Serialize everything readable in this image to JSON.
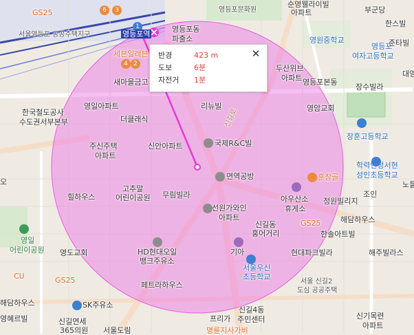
{
  "popup": {
    "radius_key": "반경",
    "radius_value": "423 m",
    "walk_key": "도보",
    "walk_value": "6분",
    "bike_key": "자전거",
    "bike_value": "1분",
    "close_icon": "close-icon"
  },
  "labels": {
    "gs25_top": "GS25",
    "seoul_hangul": "서울영등포 공공주택지구",
    "station": "영등포역",
    "yeongdeungpo_transfer": "영등포역",
    "yeongdeungpo_market_top": "영등포동",
    "yeongdeungpo_market2": "파출소",
    "sewoon": "세븐일레븐",
    "semaeul": "새마을금고",
    "youngil_apt": "영일아파트",
    "deokraesik": "더클래식",
    "korea_rail": "한국철도공사",
    "metro_west": "수도권서부본부",
    "jusin_apt": "주신주택",
    "jusin_apt2": "아파트",
    "gohun": "고추말",
    "gohun2": "어린이공원",
    "hillhouse": "힐하우스",
    "muri": "무림빌라",
    "sinsam": "신안아파트",
    "ribil": "리뉴빌",
    "guksae": "국제R&C빌",
    "myeonyeok": "면역공방",
    "sinan_apt": "선원가와인",
    "sinan_apt2": "아파트",
    "singil_dong": "신길동",
    "hongeo": "홍어거리",
    "gia": "기아",
    "seoul_school": "서울우신",
    "seoul_school2": "초등학교",
    "hd_hyundai": "HD현대오일",
    "hd_hyundai2": "뱅크주유소",
    "petera": "페트라하우스",
    "ydhome": "영도교회",
    "yeongil_park": "영일",
    "yeongil_park2": "어린이공원",
    "cu": "CU",
    "gs25_mid": "GS25",
    "sk": "SK주유소",
    "frego": "프리가",
    "singil4": "신길4동",
    "singil4_2": "주민센터",
    "singil_center": "신길연세",
    "singil_center2": "365의원",
    "seoul_dorim": "서울도림",
    "haedam": "해담하우스",
    "yeonghye": "영혜르빌",
    "dusan": "두산위브",
    "dusan2": "아파트",
    "yeongampo": "영등포본동",
    "jangsu": "장수빌라",
    "yeongam_church": "영암교회",
    "jangwon_school": "장훈고등학교",
    "haklyeok": "학력인정서현",
    "haklyeok2": "성인초등학교",
    "hunjanggol": "훈장골",
    "ausan": "아우산소",
    "ausan2": "휴게소",
    "jeongwon": "정원빌리지",
    "haedam2": "해담하우스",
    "hansol": "한솔아트빌",
    "hyundai_park": "현대파크빌라",
    "gs25_right": "GS25",
    "haejusang": "해주빌라스",
    "seoul_singil2": "서울 신길2",
    "seoul_singil2b": "도심 공공주택",
    "singil_mok": "신기목련",
    "singil_mok2": "아파트",
    "soonyeong": "순영웰라이빌",
    "soonyeong2": "아파트",
    "yeongdeungpo_hall": "영등포문화원",
    "yeongwon_mid": "영원중학교",
    "yeongwon_girl": "영등포",
    "yeongwon_girl2": "여자고등학교",
    "hansbil": "한스빌",
    "junta": "준타빌",
    "daeyoung": "대영",
    "yeongdong": "영등포동",
    "right_top": "부군당",
    "dongsamjo": "영등포동",
    "jobin": "조인",
    "nodeul": "노들",
    "sinanpark": "신길로",
    "road_singil": "신길로",
    "o_label": "오",
    "badge_1": "1",
    "badge_6": "6",
    "badge_3": "3",
    "badge_4": "4",
    "badge_2": "2",
    "bottom_red": "명륜지사가비"
  }
}
